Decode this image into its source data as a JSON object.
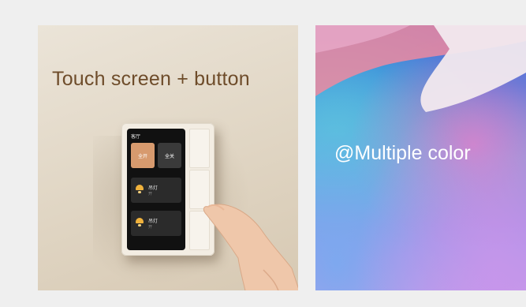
{
  "left_panel": {
    "title": "Touch screen + button",
    "device": {
      "screen_title": "客厅",
      "tile_on": "全开",
      "tile_off": "全关",
      "rows": [
        {
          "label": "吊灯",
          "sub": "开"
        },
        {
          "label": "吊灯",
          "sub": "开"
        }
      ]
    }
  },
  "right_panel": {
    "title": "@Multiple color"
  }
}
